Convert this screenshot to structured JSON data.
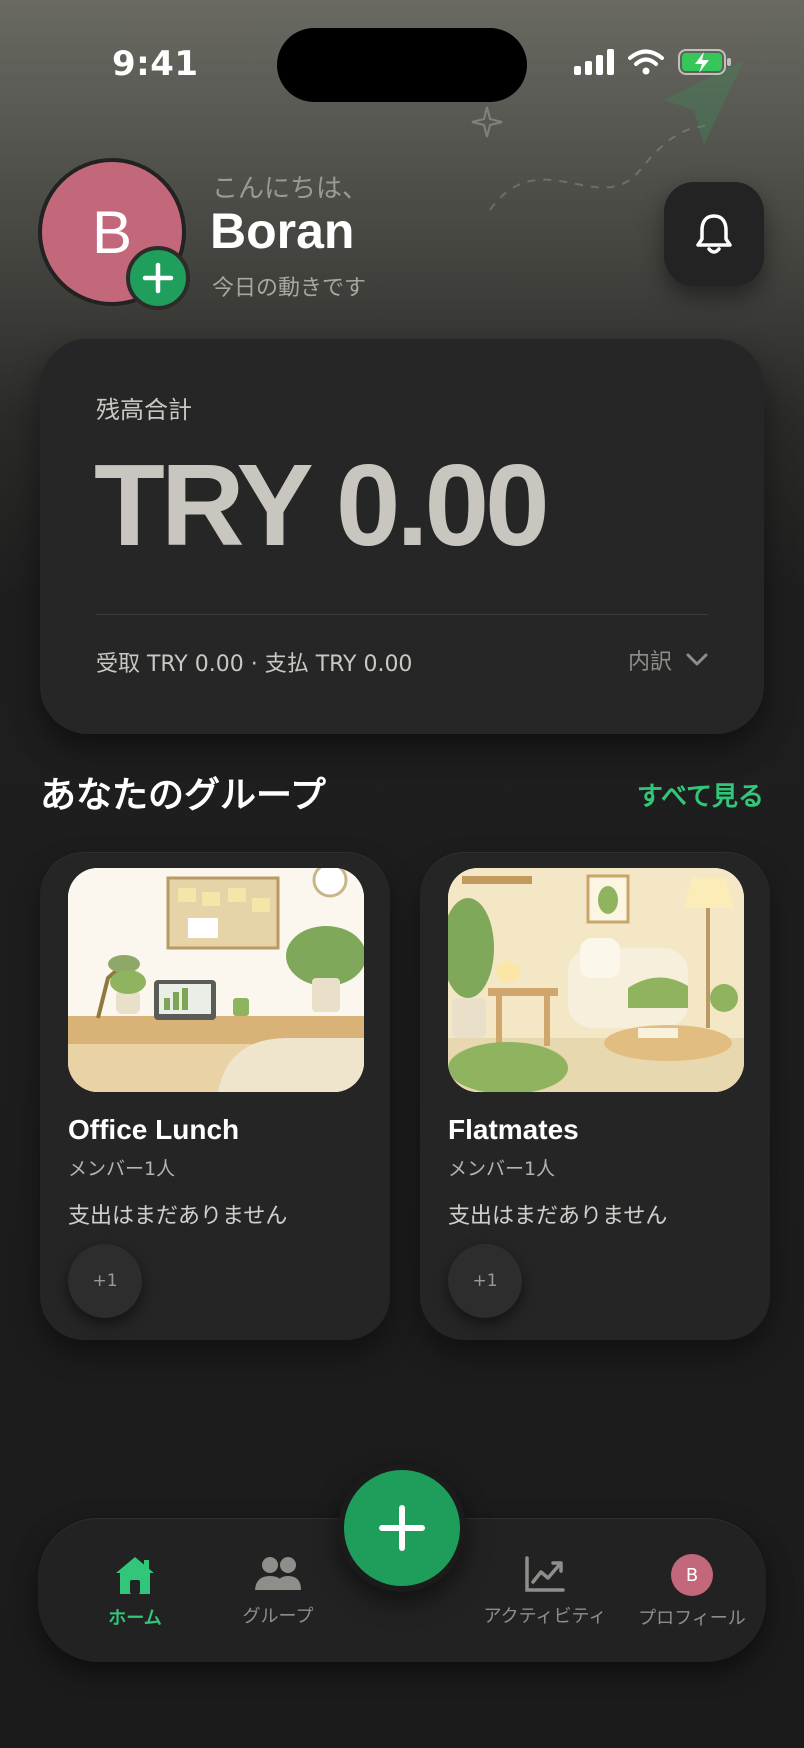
{
  "status_bar": {
    "time": "9:41"
  },
  "header": {
    "avatar_initial": "B",
    "greeting": "こんにちは、",
    "user_name": "Boran",
    "subtitle": "今日の動きです"
  },
  "balance": {
    "label": "残高合計",
    "amount": "TRY 0.00",
    "detail": "受取 TRY 0.00 · 支払 TRY 0.00",
    "breakdown_label": "内訳"
  },
  "groups_section": {
    "title": "あなたのグループ",
    "see_all": "すべて見る",
    "groups": [
      {
        "name": "Office Lunch",
        "members": "メンバー1人",
        "expense_status": "支出はまだありません",
        "badge": "+1"
      },
      {
        "name": "Flatmates",
        "members": "メンバー1人",
        "expense_status": "支出はまだありません",
        "badge": "+1"
      }
    ]
  },
  "nav": {
    "items": [
      {
        "label": "ホーム",
        "icon": "home-icon",
        "active": true
      },
      {
        "label": "グループ",
        "icon": "users-icon",
        "active": false
      },
      {
        "label": "アクティビティ",
        "icon": "chart-icon",
        "active": false
      },
      {
        "label": "プロフィール",
        "icon": "avatar",
        "active": false
      }
    ],
    "profile_initial": "B"
  },
  "colors": {
    "accent_green": "#32c67a",
    "fab_green": "#1e9d5b",
    "avatar_pink": "#c2687a",
    "card_bg": "#262626"
  }
}
